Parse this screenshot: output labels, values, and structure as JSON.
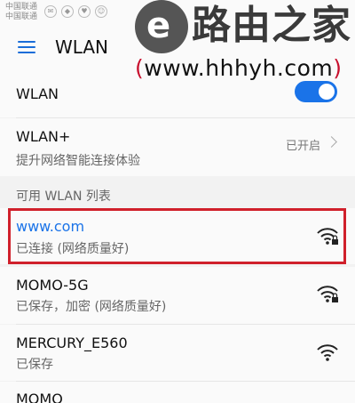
{
  "status_bar": {
    "carrier_1": "中国联通",
    "carrier_2": "中国联通"
  },
  "app_bar": {
    "title": "WLAN",
    "menu_icon": "menu-icon"
  },
  "watermark": {
    "logo_letter": "e",
    "name": "路由之家",
    "url_open": "(",
    "url": "www.hhhyh.com",
    "url_close": ")"
  },
  "wlan_toggle": {
    "label": "WLAN",
    "state": "on"
  },
  "wlan_plus": {
    "label": "WLAN+",
    "description": "提升网络智能连接体验",
    "status": "已开启"
  },
  "networks_section": {
    "header": "可用 WLAN 列表"
  },
  "networks": [
    {
      "ssid": "www.com",
      "status": "已连接 (网络质量好)",
      "locked": true,
      "connected": true
    },
    {
      "ssid": "MOMO-5G",
      "status": "已保存，加密 (网络质量好)",
      "locked": true,
      "connected": false
    },
    {
      "ssid": "MERCURY_E560",
      "status": "已保存",
      "locked": false,
      "connected": false
    },
    {
      "ssid": "MOMO",
      "status": "",
      "locked": false,
      "connected": false
    }
  ],
  "colors": {
    "accent": "#1a73e8",
    "highlight": "#d0202b",
    "background": "#f2f2f2"
  }
}
